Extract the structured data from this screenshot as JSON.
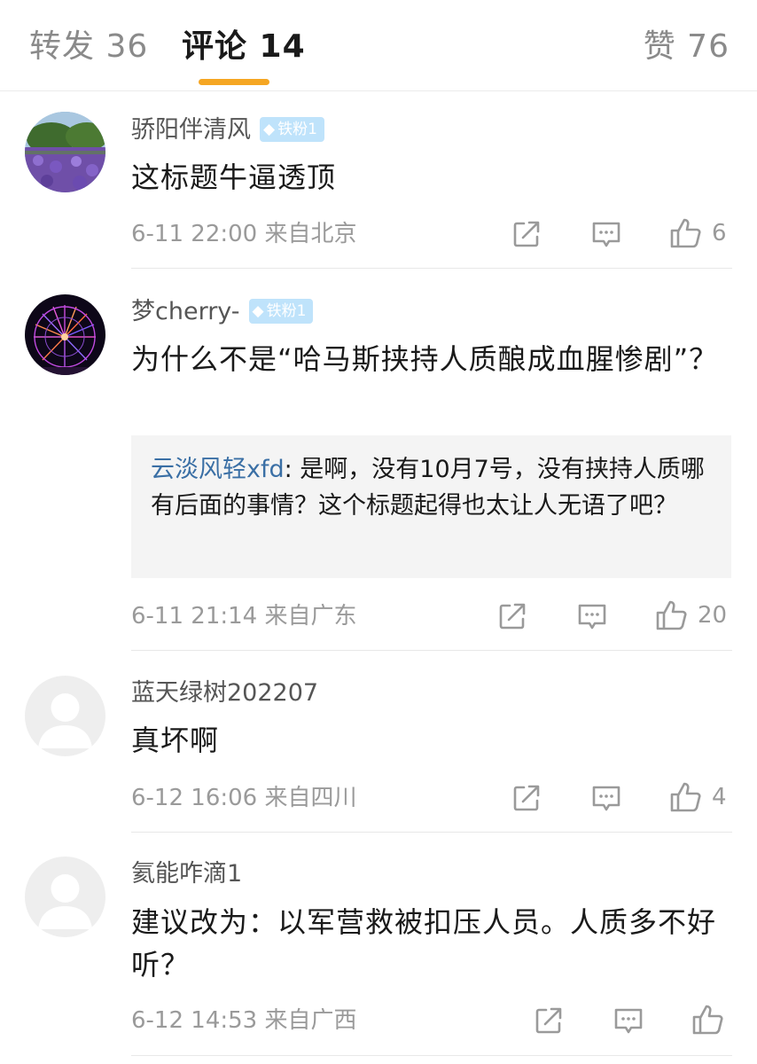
{
  "tabs": {
    "repost": "转发 36",
    "comment": "评论 14",
    "like": "赞 76"
  },
  "colors": {
    "accent": "#f5a623",
    "reply_username": "#3a6fa5",
    "badge_bg": "#bfe3fb",
    "meta_gray": "#9a9a9a"
  },
  "comments": [
    {
      "username": "骄阳伴清风",
      "badge": "铁粉1",
      "text": "这标题牛逼透顶",
      "meta": "6-11 22:00 来自北京",
      "likes": "6",
      "avatar": "photo-lavender-field"
    },
    {
      "username": "梦cherry-",
      "badge": "铁粉1",
      "text": "为什么不是“哈马斯挟持人质酿成血腥惨剧”？",
      "reply_user": "云淡风轻xfd",
      "reply_text": ": 是啊，没有10月7号，没有挟持人质哪有后面的事情？这个标题起得也太让人无语了吧？",
      "meta": "6-11 21:14 来自广东",
      "likes": "20",
      "avatar": "photo-ferris-wheel-night"
    },
    {
      "username": "蓝天绿树202207",
      "text": "真坏啊",
      "meta": "6-12 16:06 来自四川",
      "likes": "4",
      "avatar": "default-user-icon"
    },
    {
      "username": "氦能咋滴1",
      "text": "建议改为：以军营救被扣压人员。人质多不好听？",
      "meta": "6-12 14:53 来自广西",
      "likes": "",
      "avatar": "default-user-icon"
    }
  ],
  "icons": {
    "share": "share-icon",
    "comment": "comment-icon",
    "like": "thumbs-up-icon",
    "badge": "diamond-icon"
  }
}
